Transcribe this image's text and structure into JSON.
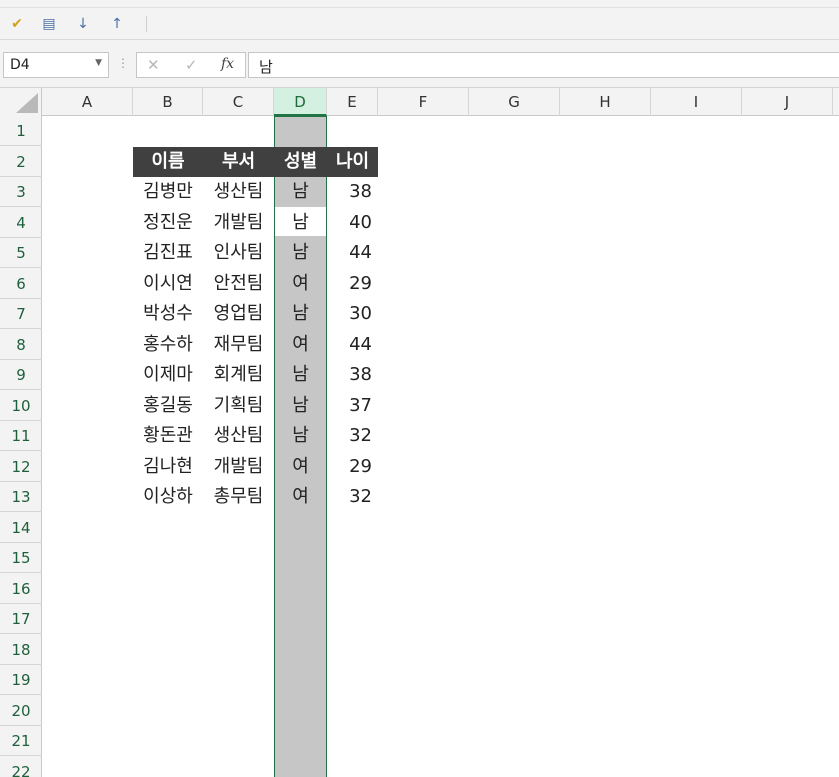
{
  "toolbar": {
    "icons": [
      "brush-icon",
      "filter-icon",
      "sort-asc-icon",
      "sort-desc-icon"
    ],
    "glyphs": [
      "✔",
      "▤",
      "↓",
      "↑"
    ]
  },
  "formula_bar": {
    "name_box": "D4",
    "cancel_glyph": "✕",
    "enter_glyph": "✓",
    "fx_label": "fx",
    "content": "남"
  },
  "columns": [
    "A",
    "B",
    "C",
    "D",
    "E",
    "F",
    "G",
    "H",
    "I",
    "J"
  ],
  "selected_column": "D",
  "active_cell": "D4",
  "rows": [
    "1",
    "2",
    "3",
    "4",
    "5",
    "6",
    "7",
    "8",
    "9",
    "10",
    "11",
    "12",
    "13",
    "14",
    "15",
    "16",
    "17",
    "18",
    "19",
    "20",
    "21",
    "22"
  ],
  "table": {
    "headers": [
      "이름",
      "부서",
      "성별",
      "나이"
    ],
    "records": [
      [
        "김병만",
        "생산팀",
        "남",
        "38"
      ],
      [
        "정진운",
        "개발팀",
        "남",
        "40"
      ],
      [
        "김진표",
        "인사팀",
        "남",
        "44"
      ],
      [
        "이시연",
        "안전팀",
        "여",
        "29"
      ],
      [
        "박성수",
        "영업팀",
        "남",
        "30"
      ],
      [
        "홍수하",
        "재무팀",
        "여",
        "44"
      ],
      [
        "이제마",
        "회계팀",
        "남",
        "38"
      ],
      [
        "홍길동",
        "기획팀",
        "남",
        "37"
      ],
      [
        "황돈관",
        "생산팀",
        "남",
        "32"
      ],
      [
        "김나현",
        "개발팀",
        "여",
        "29"
      ],
      [
        "이상하",
        "총무팀",
        "여",
        "32"
      ]
    ]
  },
  "colors": {
    "accent": "#217346",
    "header_fill": "#404040",
    "selection_fill": "#c6c6c6"
  }
}
